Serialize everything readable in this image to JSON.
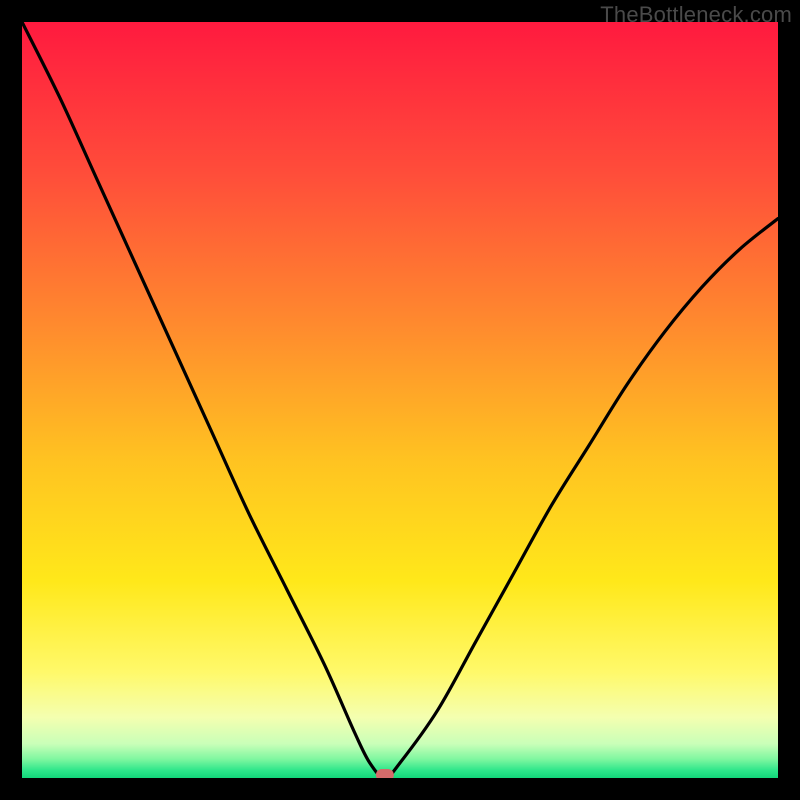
{
  "watermark": "TheBottleneck.com",
  "chart_data": {
    "type": "line",
    "title": "",
    "xlabel": "",
    "ylabel": "",
    "xlim": [
      0,
      100
    ],
    "ylim": [
      0,
      100
    ],
    "x": [
      0,
      5,
      10,
      15,
      20,
      25,
      30,
      35,
      40,
      44,
      46,
      48,
      50,
      55,
      60,
      65,
      70,
      75,
      80,
      85,
      90,
      95,
      100
    ],
    "values": [
      100,
      90,
      79,
      68,
      57,
      46,
      35,
      25,
      15,
      6,
      2,
      0,
      2,
      9,
      18,
      27,
      36,
      44,
      52,
      59,
      65,
      70,
      74
    ],
    "minimum_x": 48,
    "minimum_y": 0,
    "marker": {
      "x": 48,
      "y": 0,
      "color": "#d46a6a"
    },
    "gradient_stops": [
      {
        "offset": 0.0,
        "color": "#ff1a3f"
      },
      {
        "offset": 0.2,
        "color": "#ff4d3a"
      },
      {
        "offset": 0.4,
        "color": "#ff8a2e"
      },
      {
        "offset": 0.58,
        "color": "#ffc321"
      },
      {
        "offset": 0.74,
        "color": "#ffe81a"
      },
      {
        "offset": 0.86,
        "color": "#fff96a"
      },
      {
        "offset": 0.92,
        "color": "#f4ffb0"
      },
      {
        "offset": 0.955,
        "color": "#c9ffb8"
      },
      {
        "offset": 0.975,
        "color": "#7ff7a0"
      },
      {
        "offset": 0.99,
        "color": "#2de68a"
      },
      {
        "offset": 1.0,
        "color": "#12d67a"
      }
    ]
  }
}
